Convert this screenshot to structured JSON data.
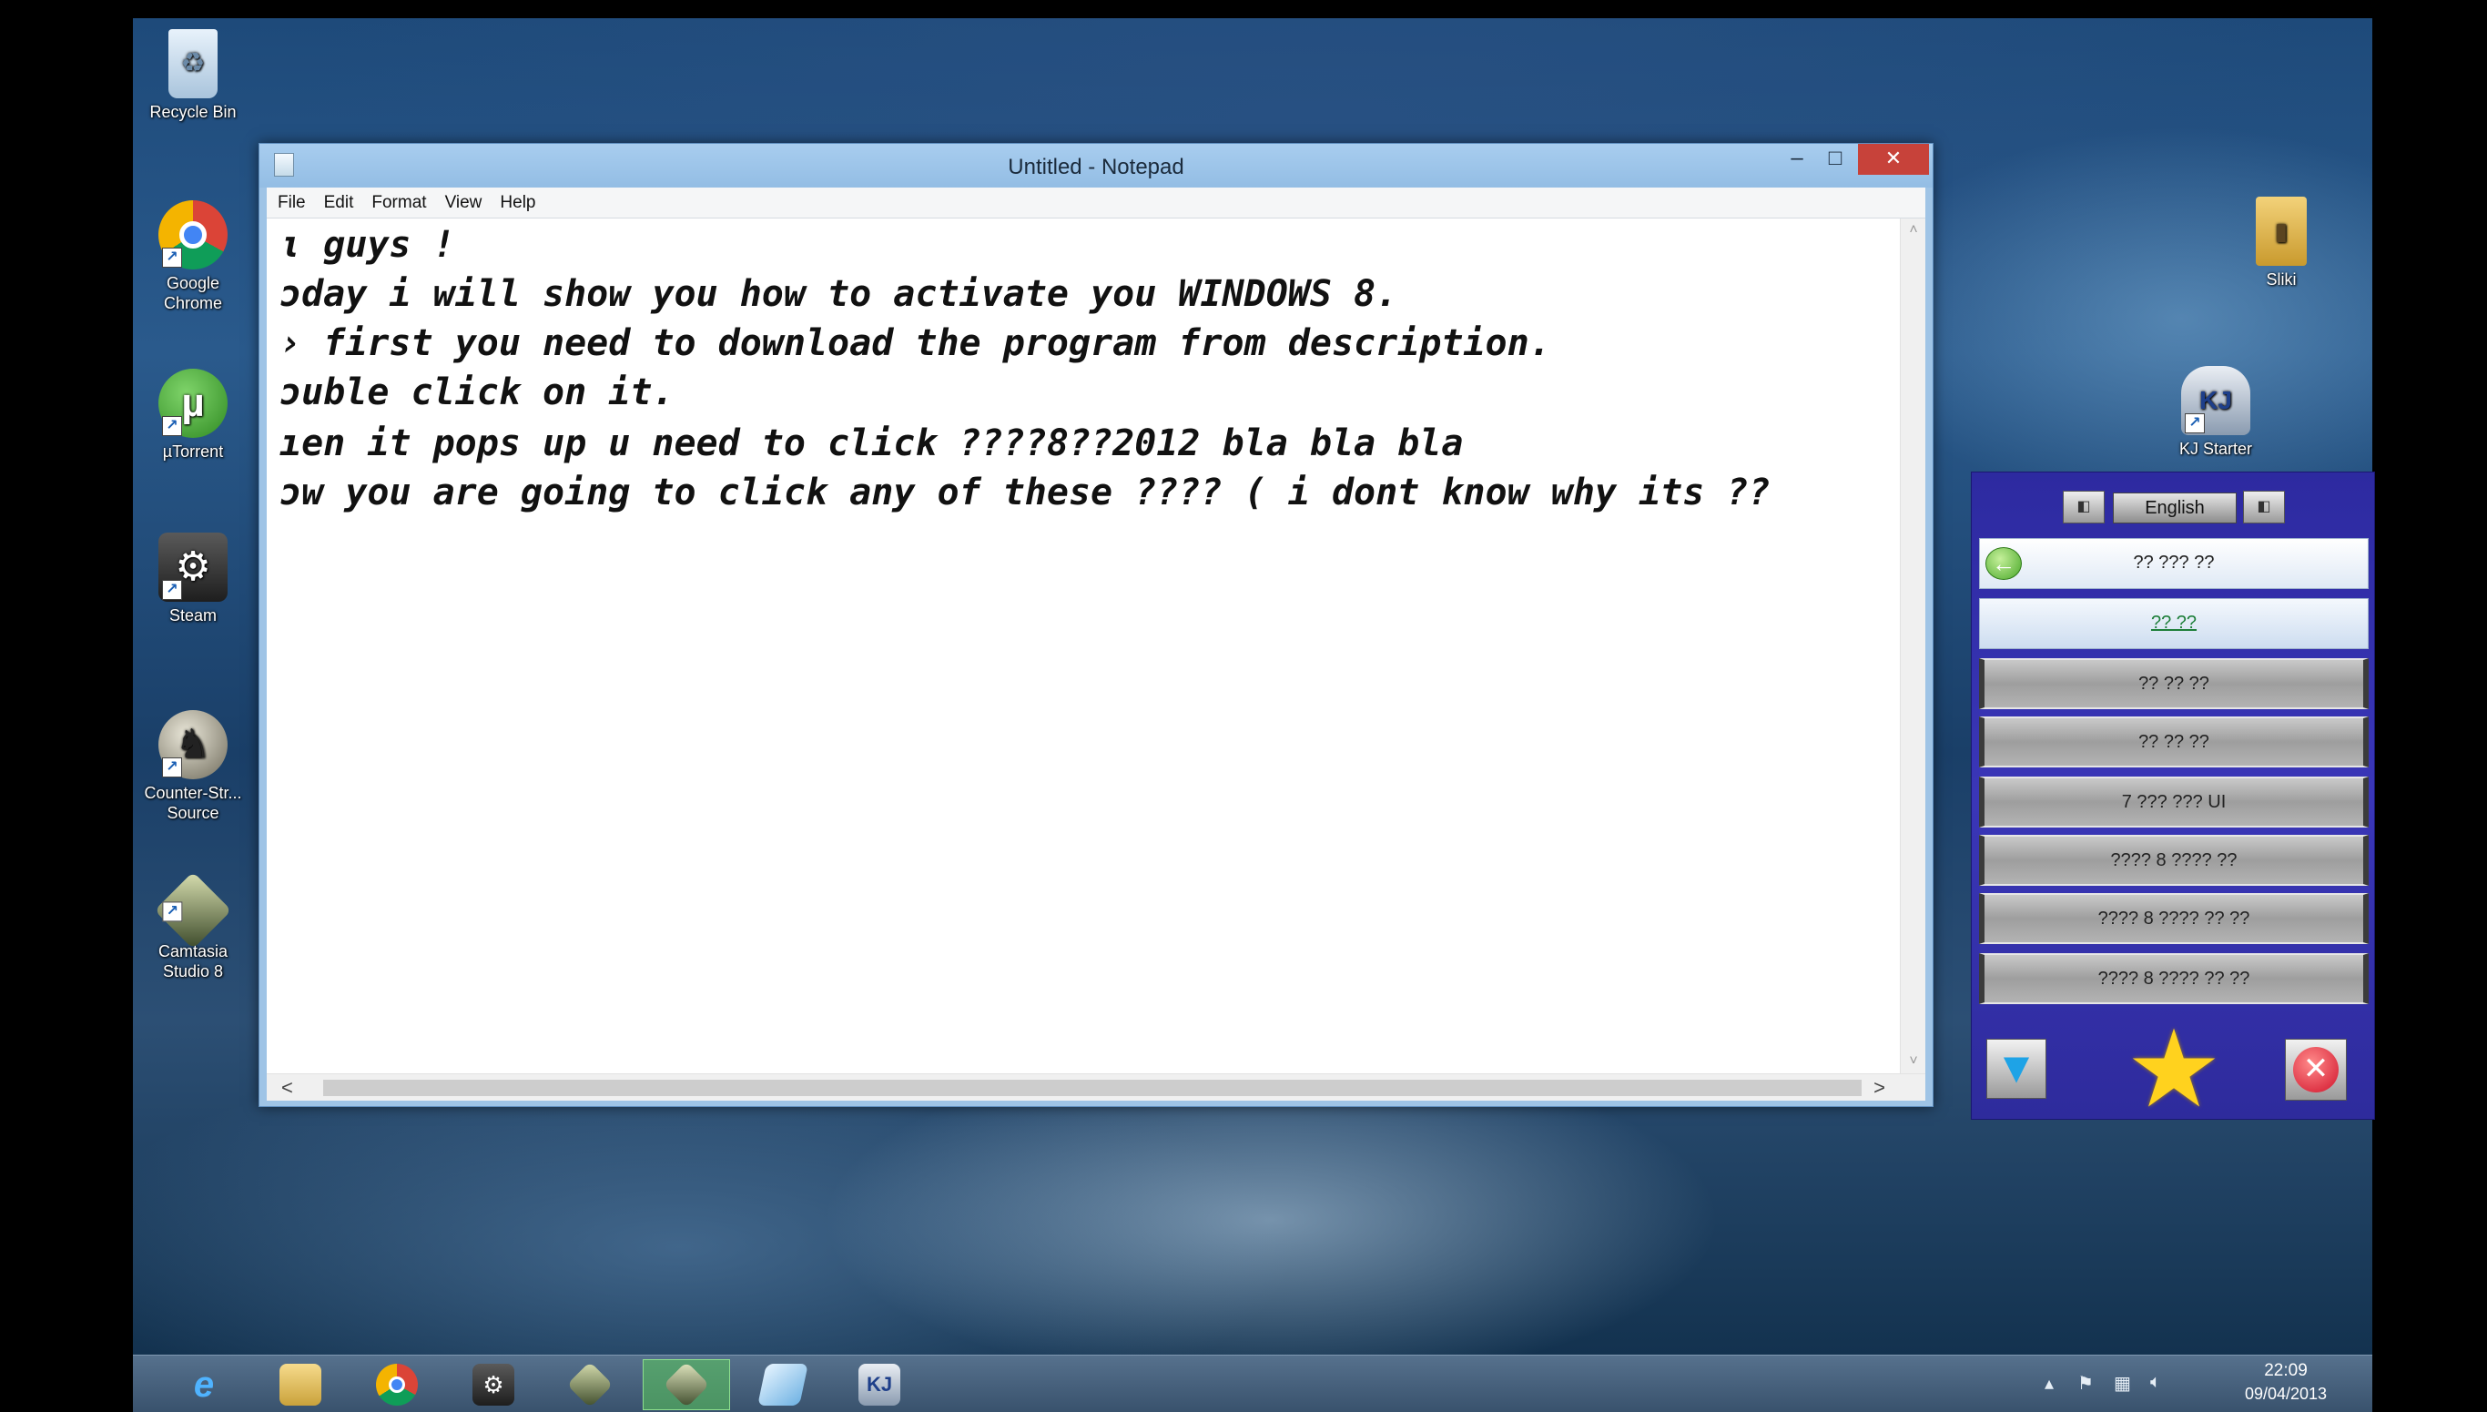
{
  "desktop": {
    "icons": [
      {
        "label": "Recycle Bin"
      },
      {
        "label": "Google Chrome"
      },
      {
        "label": "µTorrent"
      },
      {
        "label": "Steam"
      },
      {
        "label": "Counter-Str... Source"
      },
      {
        "label": "Camtasia Studio 8"
      },
      {
        "label": "Sliki"
      },
      {
        "label": "KJ Starter"
      }
    ]
  },
  "notepad": {
    "title": "Untitled - Notepad",
    "minimize": "–",
    "maximize": "□",
    "close": "✕",
    "menu": [
      "File",
      "Edit",
      "Format",
      "View",
      "Help"
    ],
    "lines": [
      "ι guys !",
      "ɔday i will show you how to activate you WINDOWS 8.",
      "› first you need to download the program from description.",
      "ɔuble click on it.",
      "ıen it pops up u need to click ????8??2012 bla bla bla",
      "ɔw you are going to click any of these ???? ( i dont know why its ??"
    ],
    "scroll_left": "<",
    "scroll_right": ">"
  },
  "activator": {
    "language": "English",
    "buttons": [
      "?? ??? ??",
      "?? ??",
      "?? ?? ??",
      "?? ?? ??",
      "7 ??? ??? UI",
      "???? 8 ???? ??",
      "???? 8 ???? ?? ??",
      "???? 8 ???? ?? ??"
    ]
  },
  "taskbar": {
    "clock_time": "22:09",
    "clock_date": "09/04/2013"
  },
  "colors": {
    "activator_bg": "#3a36b8",
    "close_button": "#c7423a",
    "taskbar": "#46607c"
  }
}
